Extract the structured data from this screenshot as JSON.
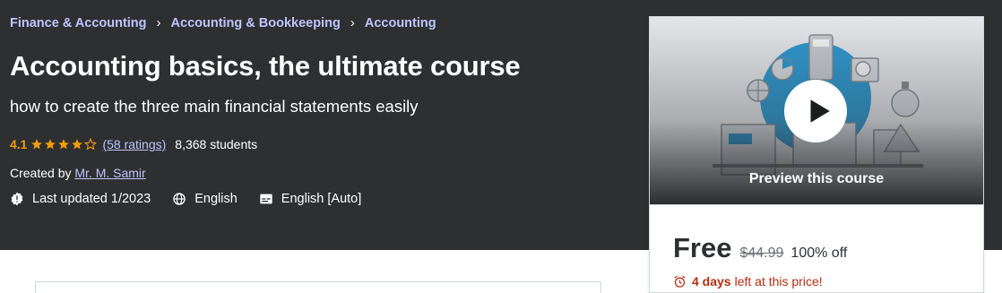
{
  "breadcrumb": {
    "items": [
      "Finance & Accounting",
      "Accounting & Bookkeeping",
      "Accounting"
    ],
    "separator": "›"
  },
  "course": {
    "title": "Accounting basics, the ultimate course",
    "subtitle": "how to create the three main financial statements easily",
    "rating": "4.1",
    "rating_value": 4.1,
    "rating_max": 5,
    "ratings_link": "(58 ratings)",
    "students": "8,368 students",
    "created_by_label": "Created by",
    "instructor": "Mr. M. Samir",
    "last_updated": "Last updated 1/2023",
    "language": "English",
    "captions": "English [Auto]"
  },
  "sidebar": {
    "preview_label": "Preview this course",
    "price_current": "Free",
    "price_original": "$44.99",
    "discount": "100% off",
    "timer_bold": "4 days",
    "timer_rest": "left at this price!"
  },
  "colors": {
    "hero_bg": "#2d2f31",
    "link_purple": "#c0c4fc",
    "star_orange": "#f69c08",
    "alert_red": "#b32d0f"
  },
  "icons": {
    "star": "star-icon",
    "updated": "alert-badge-icon",
    "language": "globe-icon",
    "captions": "closed-captions-icon",
    "play": "play-icon",
    "timer": "alarm-clock-icon"
  }
}
